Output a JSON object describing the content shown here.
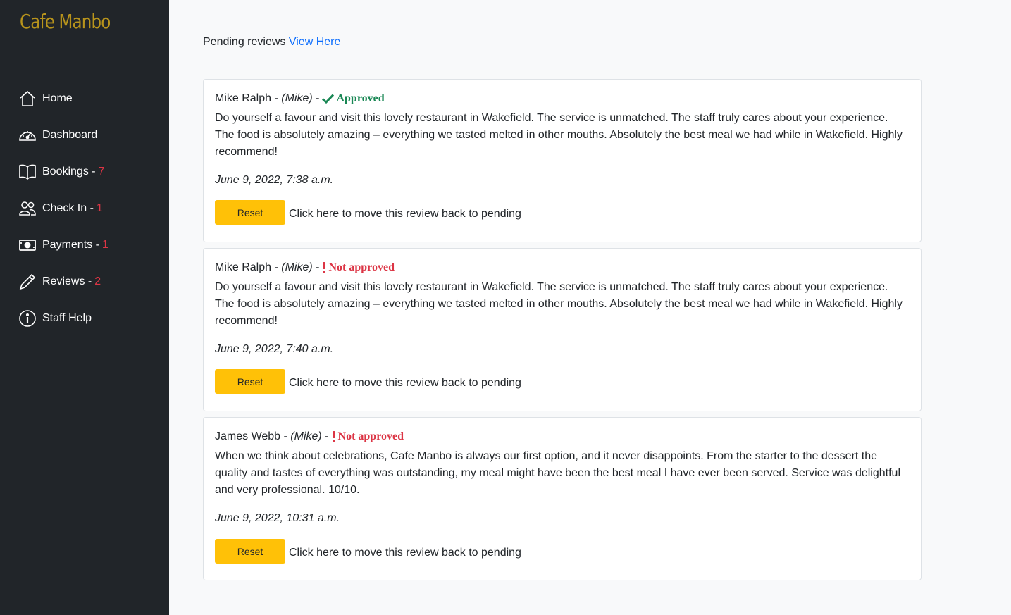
{
  "brand": "Cafe Manbo",
  "nav": [
    {
      "label": "Home",
      "count": "",
      "icon": "house-icon"
    },
    {
      "label": "Dashboard",
      "count": "",
      "icon": "speedometer-icon"
    },
    {
      "label": "Bookings",
      "count": "7",
      "icon": "book-icon"
    },
    {
      "label": "Check In",
      "count": "1",
      "icon": "people-icon"
    },
    {
      "label": "Payments",
      "count": "1",
      "icon": "cash-icon"
    },
    {
      "label": "Reviews",
      "count": "2",
      "icon": "pencil-icon"
    },
    {
      "label": "Staff Help",
      "count": "",
      "icon": "info-icon"
    }
  ],
  "pending": {
    "label": "Pending reviews",
    "link": "View Here"
  },
  "reviews": [
    {
      "author": "Mike Ralph",
      "alias": "(Mike)",
      "status": "Approved",
      "text": "Do yourself a favour and visit this lovely restaurant in Wakefield. The service is unmatched. The staff truly cares about your experience. The food is absolutely amazing – everything we tasted melted in other mouths. Absolutely the best meal we had while in Wakefield. Highly recommend!",
      "date": "June 9, 2022, 7:38 a.m.",
      "button": "Reset",
      "hint": "Click here to move this review back to pending"
    },
    {
      "author": "Mike Ralph",
      "alias": "(Mike)",
      "status": "Not approved",
      "text": "Do yourself a favour and visit this lovely restaurant in Wakefield. The service is unmatched. The staff truly cares about your experience. The food is absolutely amazing – everything we tasted melted in other mouths. Absolutely the best meal we had while in Wakefield. Highly recommend!",
      "date": "June 9, 2022, 7:40 a.m.",
      "button": "Reset",
      "hint": "Click here to move this review back to pending"
    },
    {
      "author": "James Webb",
      "alias": "(Mike)",
      "status": "Not approved",
      "text": "When we think about celebrations, Cafe Manbo is always our first option, and it never disappoints. From the starter to the dessert the quality and tastes of everything was outstanding, my meal might have been the best meal I have ever been served. Service was delightful and very professional. 10/10.",
      "date": "June 9, 2022, 10:31 a.m.",
      "button": "Reset",
      "hint": "Click here to move this review back to pending"
    }
  ],
  "colors": {
    "sidebar": "#212529",
    "brand": "#b8941c",
    "approved": "#198754",
    "not_approved": "#dc3545",
    "button": "#ffc107",
    "link": "#0d6efd"
  }
}
